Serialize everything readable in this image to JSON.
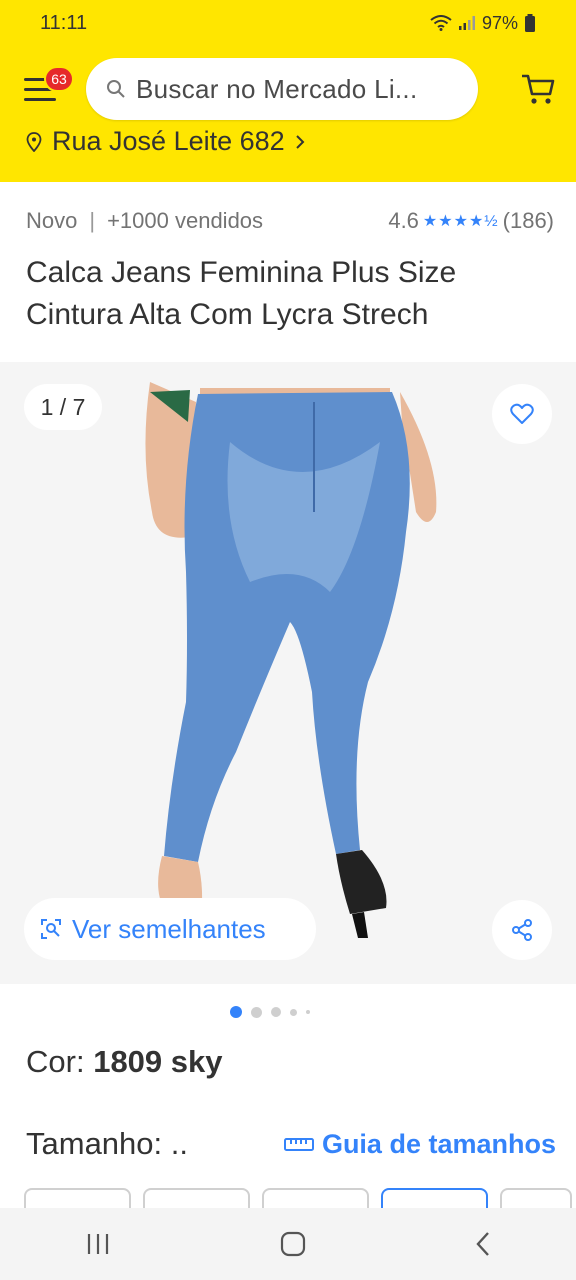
{
  "status_bar": {
    "time": "11:11",
    "battery": "97%"
  },
  "header": {
    "notification_count": "63",
    "search_placeholder": "Buscar no Mercado Li...",
    "address": "Rua José Leite 682"
  },
  "product": {
    "condition": "Novo",
    "sold": "+1000 vendidos",
    "rating": "4.6",
    "reviews": "(186)",
    "title": "Calca Jeans Feminina Plus Size Cintura Alta Com Lycra Strech"
  },
  "gallery": {
    "counter": "1 / 7",
    "similar_label": "Ver semelhantes"
  },
  "variants": {
    "color_label": "Cor:",
    "color_value": "1809 sky",
    "size_label": "Tamanho: ..",
    "size_guide_label": "Guia de tamanhos"
  },
  "colors": {
    "brand_yellow": "#ffe600",
    "accent_blue": "#3483fa",
    "badge_red": "#e62a2a"
  }
}
